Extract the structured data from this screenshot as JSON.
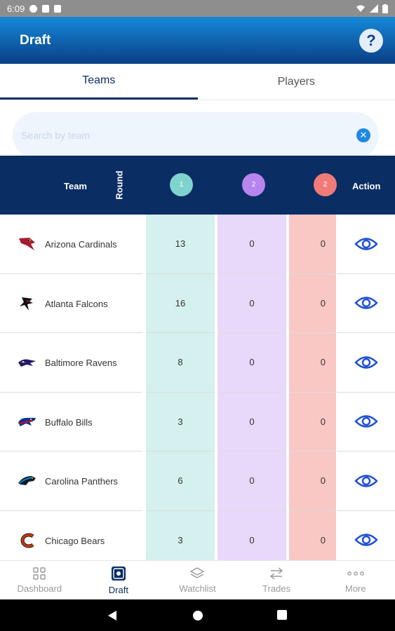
{
  "status_bar": {
    "time": "6:09"
  },
  "app_bar": {
    "title": "Draft",
    "help_label": "?"
  },
  "tabs": [
    {
      "label": "Teams",
      "active": true
    },
    {
      "label": "Players",
      "active": false
    }
  ],
  "search": {
    "placeholder": "Search by team",
    "value": "",
    "clear_icon": "close-icon"
  },
  "table": {
    "headers": {
      "team": "Team",
      "round": "Round",
      "rounds": [
        {
          "label": "1",
          "color": "#7ed4cd"
        },
        {
          "label": "2",
          "color": "#b884ee"
        },
        {
          "label": "2",
          "color": "#f07b78"
        }
      ],
      "action": "Action"
    },
    "rows": [
      {
        "team": "Arizona Cardinals",
        "logo": "cardinals-logo",
        "r1": "13",
        "r2": "0",
        "r3": "0",
        "action_icon": "eye-icon"
      },
      {
        "team": "Atlanta Falcons",
        "logo": "falcons-logo",
        "r1": "16",
        "r2": "0",
        "r3": "0",
        "action_icon": "eye-icon"
      },
      {
        "team": "Baltimore Ravens",
        "logo": "ravens-logo",
        "r1": "8",
        "r2": "0",
        "r3": "0",
        "action_icon": "eye-icon"
      },
      {
        "team": "Buffalo Bills",
        "logo": "bills-logo",
        "r1": "3",
        "r2": "0",
        "r3": "0",
        "action_icon": "eye-icon"
      },
      {
        "team": "Carolina Panthers",
        "logo": "panthers-logo",
        "r1": "6",
        "r2": "0",
        "r3": "0",
        "action_icon": "eye-icon"
      },
      {
        "team": "Chicago Bears",
        "logo": "bears-logo",
        "r1": "3",
        "r2": "0",
        "r3": "0",
        "action_icon": "eye-icon"
      }
    ]
  },
  "bottom_nav": [
    {
      "label": "Dashboard",
      "icon": "grid-icon",
      "active": false
    },
    {
      "label": "Draft",
      "icon": "draft-icon",
      "active": true
    },
    {
      "label": "Watchlist",
      "icon": "layers-icon",
      "active": false
    },
    {
      "label": "Trades",
      "icon": "swap-icon",
      "active": false
    },
    {
      "label": "More",
      "icon": "more-icon",
      "active": false
    }
  ],
  "colors": {
    "header_navy": "#0a2d63",
    "accent_blue": "#1e88e5",
    "eye_blue": "#1d4fd6"
  }
}
